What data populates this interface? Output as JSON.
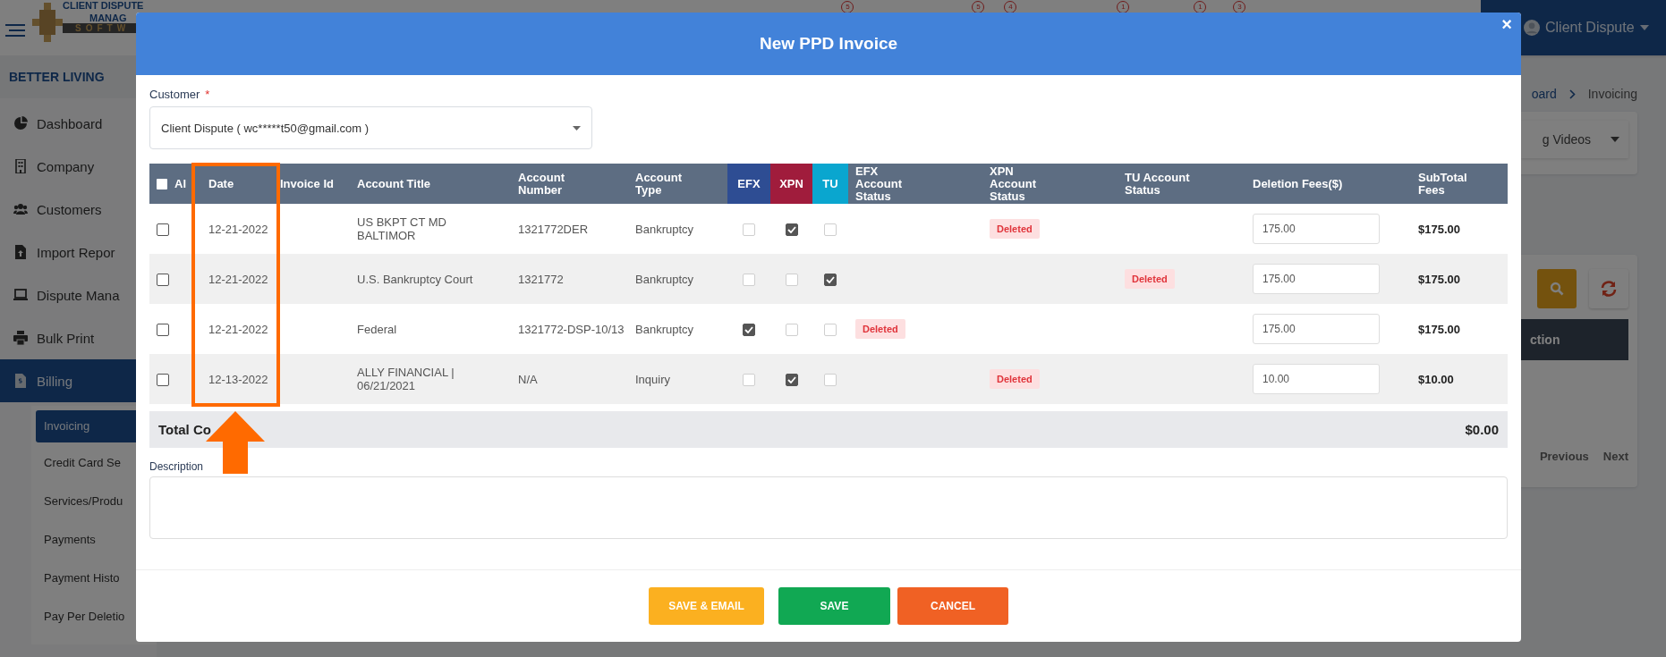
{
  "app": {
    "logo_lines": [
      "CLIENT DISPUTE",
      "MANAG",
      "SOFTW"
    ],
    "notification_badges": [
      "5",
      "5",
      "4",
      "1",
      "1",
      "3"
    ],
    "user": {
      "name": "Client Dispute"
    },
    "company": "BETTER LIVING",
    "sidebar": {
      "items": [
        {
          "label": "Dashboard",
          "selected": false
        },
        {
          "label": "Company",
          "selected": false
        },
        {
          "label": "Customers",
          "selected": false
        },
        {
          "label": "Import Repor",
          "selected": false
        },
        {
          "label": "Dispute Mana",
          "selected": false
        },
        {
          "label": "Bulk Print",
          "selected": false
        },
        {
          "label": "Billing",
          "selected": true,
          "expanded": true,
          "children": [
            {
              "label": "Invoicing",
              "selected": true
            },
            {
              "label": "Credit Card Se",
              "selected": false
            },
            {
              "label": "Services/Produ",
              "selected": false
            },
            {
              "label": "Payments",
              "selected": false
            },
            {
              "label": "Payment Histo",
              "selected": false
            },
            {
              "label": "Pay Per Deletio",
              "selected": false
            }
          ]
        }
      ]
    },
    "breadcrumb": [
      "oard",
      "Invoicing"
    ],
    "video_select": "g Videos",
    "action_bar": "ction",
    "pagination": [
      "Previous",
      "Next"
    ]
  },
  "dialog": {
    "title": "New PPD Invoice",
    "close": "×",
    "customer": {
      "label": "Customer",
      "required_mark": "*",
      "value": "Client Dispute ( wc*****t50@gmail.com )"
    },
    "table": {
      "columns": [
        {
          "label": "Al",
          "kind": "select-all",
          "checked": false
        },
        {
          "label": "Date",
          "kind": "text"
        },
        {
          "label": "Invoice Id",
          "kind": "text"
        },
        {
          "label": "Account Title",
          "kind": "text"
        },
        {
          "label": "Account Number",
          "kind": "text"
        },
        {
          "label": "Account Type",
          "kind": "text"
        },
        {
          "label": "EFX",
          "kind": "bureau",
          "color": "#2e4d93"
        },
        {
          "label": "XPN",
          "kind": "bureau",
          "color": "#a01c3c"
        },
        {
          "label": "TU",
          "kind": "bureau",
          "color": "#0aa6cf"
        },
        {
          "label": "EFX Account Status",
          "kind": "text"
        },
        {
          "label": "XPN Account Status",
          "kind": "text"
        },
        {
          "label": "TU Account Status",
          "kind": "text"
        },
        {
          "label": "Deletion Fees($)",
          "kind": "text"
        },
        {
          "label": "SubTotal Fees",
          "kind": "text"
        }
      ],
      "rows": [
        {
          "selected": false,
          "date": "12-21-2022",
          "account_title": "US BKPT CT MD BALTIMOR",
          "account_number": "1321772DER",
          "account_type": "Bankruptcy",
          "efx": false,
          "xpn": true,
          "tu": false,
          "xpn_status": "Deleted",
          "fee": "175.00",
          "subtotal": "$175.00"
        },
        {
          "selected": false,
          "date": "12-21-2022",
          "account_title": "U.S. Bankruptcy Court",
          "account_number": "1321772",
          "account_type": "Bankruptcy",
          "efx": false,
          "xpn": false,
          "tu": true,
          "tu_status": "Deleted",
          "fee": "175.00",
          "subtotal": "$175.00"
        },
        {
          "selected": false,
          "date": "12-21-2022",
          "account_title": "Federal",
          "account_number": "1321772-DSP-10/13",
          "account_type": "Bankruptcy",
          "efx": true,
          "xpn": false,
          "tu": false,
          "efx_status": "Deleted",
          "fee": "175.00",
          "subtotal": "$175.00"
        },
        {
          "selected": false,
          "date": "12-13-2022",
          "account_title": "ALLY FINANCIAL | 06/21/2021",
          "account_number": "N/A",
          "account_type": "Inquiry",
          "efx": false,
          "xpn": true,
          "tu": false,
          "xpn_status": "Deleted",
          "fee": "10.00",
          "subtotal": "$10.00"
        }
      ],
      "total": {
        "label": "Total Co",
        "amount": "$0.00"
      }
    },
    "description": {
      "label": "Description"
    },
    "buttons": [
      {
        "label": "SAVE & EMAIL",
        "kind": "save-email"
      },
      {
        "label": "SAVE",
        "kind": "save"
      },
      {
        "label": "CANCEL",
        "kind": "cancel"
      }
    ]
  }
}
